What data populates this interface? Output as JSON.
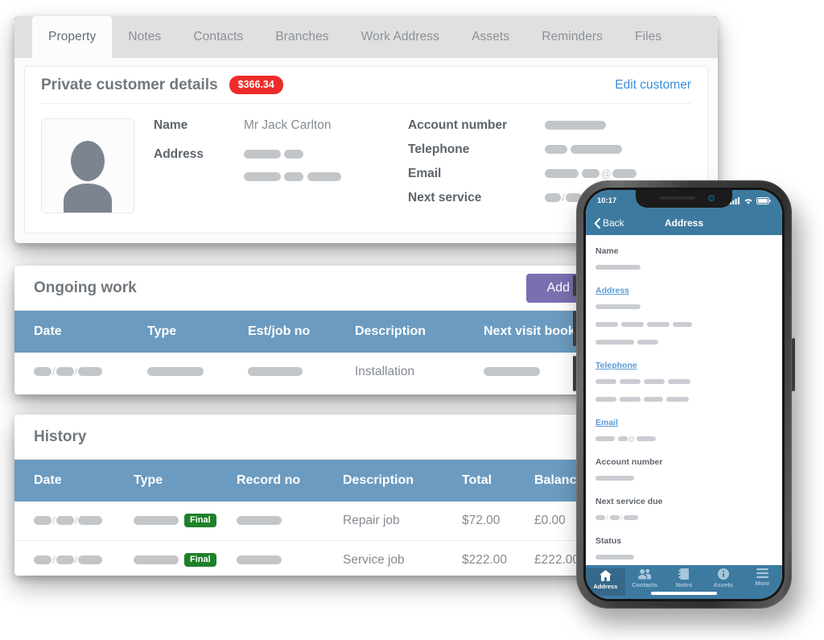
{
  "desktop": {
    "tabs": [
      {
        "label": "Property",
        "active": true
      },
      {
        "label": "Notes",
        "active": false
      },
      {
        "label": "Contacts",
        "active": false
      },
      {
        "label": "Branches",
        "active": false
      },
      {
        "label": "Work Address",
        "active": false
      },
      {
        "label": "Assets",
        "active": false
      },
      {
        "label": "Reminders",
        "active": false
      },
      {
        "label": "Files",
        "active": false
      }
    ],
    "customer_card": {
      "title": "Private customer details",
      "balance_badge": "$366.34",
      "balance_badge_color": "#ee2b2b",
      "edit_link": "Edit customer",
      "fields_left": [
        {
          "label": "Name",
          "value": "Mr Jack Carlton"
        },
        {
          "label": "Address",
          "value": ""
        }
      ],
      "fields_right": [
        {
          "label": "Account number",
          "value": ""
        },
        {
          "label": "Telephone",
          "value": ""
        },
        {
          "label": "Email",
          "value": ""
        },
        {
          "label": "Next service",
          "value": ""
        }
      ]
    },
    "ongoing": {
      "title": "Ongoing work",
      "add_label": "Add",
      "add_color": "#7b6fb0",
      "columns": [
        "Date",
        "Type",
        "Est/job no",
        "Description",
        "Next visit booked"
      ],
      "rows": [
        {
          "date": "",
          "type": "",
          "est_job_no": "",
          "description": "Installation",
          "next_visit": ""
        }
      ]
    },
    "history": {
      "title": "History",
      "columns": [
        "Date",
        "Type",
        "Record no",
        "Description",
        "Total",
        "Balance"
      ],
      "rows": [
        {
          "date": "",
          "type": "",
          "type_badge": "Final",
          "record_no": "",
          "description": "Repair job",
          "total": "$72.00",
          "balance": "£0.00"
        },
        {
          "date": "",
          "type": "",
          "type_badge": "Final",
          "record_no": "",
          "description": "Service job",
          "total": "$222.00",
          "balance": "£222.00"
        }
      ],
      "badge_color": "#1e8029"
    },
    "table_header_color": "#6b9bc0"
  },
  "phone": {
    "status_bar": {
      "time": "10:17"
    },
    "nav": {
      "back_label": "Back",
      "title": "Address"
    },
    "accent_color": "#3d7aa0",
    "fields": [
      {
        "label": "Name",
        "is_link": false
      },
      {
        "label": "Address",
        "is_link": true
      },
      {
        "label": "Telephone",
        "is_link": true
      },
      {
        "label": "Email",
        "is_link": true
      },
      {
        "label": "Account number",
        "is_link": false
      },
      {
        "label": "Next service due",
        "is_link": false
      },
      {
        "label": "Status",
        "is_link": false
      }
    ],
    "tabs": [
      {
        "label": "Address",
        "icon": "home-icon",
        "active": true
      },
      {
        "label": "Contacts",
        "icon": "people-icon",
        "active": false
      },
      {
        "label": "Notes",
        "icon": "notebook-icon",
        "active": false
      },
      {
        "label": "Assets",
        "icon": "info-icon",
        "active": false
      },
      {
        "label": "More",
        "icon": "hamburger-icon",
        "active": false
      }
    ]
  }
}
